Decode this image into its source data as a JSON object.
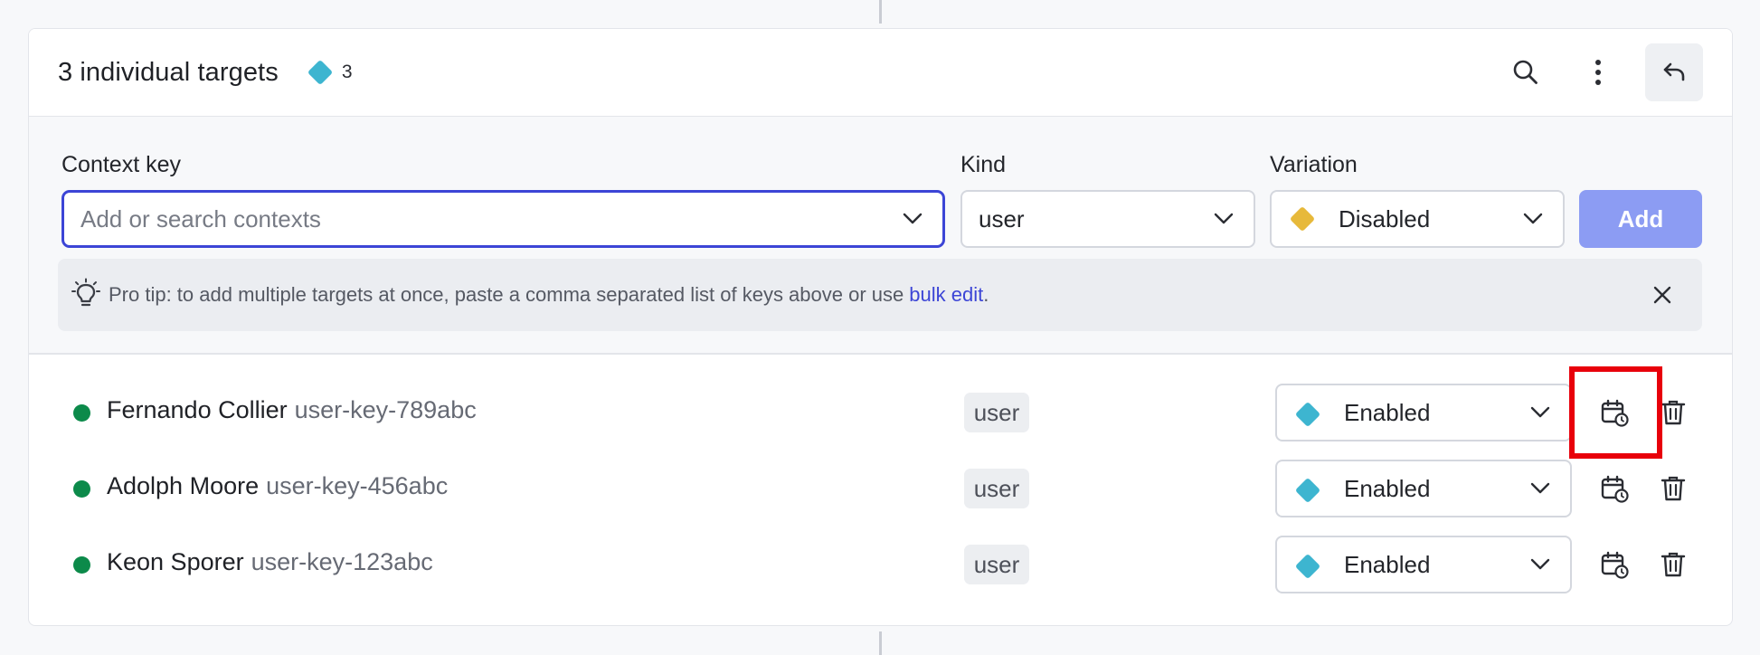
{
  "header": {
    "title": "3 individual targets",
    "count": "3",
    "count_icon": "teal-diamond-icon",
    "actions": [
      "search-icon",
      "more-vertical-icon",
      "undo-icon"
    ]
  },
  "form": {
    "context_label": "Context key",
    "context_placeholder": "Add or search contexts",
    "kind_label": "Kind",
    "kind_value": "user",
    "variation_label": "Variation",
    "variation_value": "Disabled",
    "variation_color": "#e7b93a",
    "add_label": "Add"
  },
  "tip": {
    "text": "Pro tip: to add multiple targets at once, paste a comma separated list of keys above or use",
    "link": "bulk edit",
    "suffix": "."
  },
  "targets": [
    {
      "name": "Fernando Collier",
      "key": "user-key-789abc",
      "kind": "user",
      "variation": "Enabled",
      "status_color": "#0c8a4a"
    },
    {
      "name": "Adolph Moore",
      "key": "user-key-456abc",
      "kind": "user",
      "variation": "Enabled",
      "status_color": "#0c8a4a"
    },
    {
      "name": "Keon Sporer",
      "key": "user-key-123abc",
      "kind": "user",
      "variation": "Enabled",
      "status_color": "#0c8a4a"
    }
  ],
  "colors": {
    "accent": "#3c45d6",
    "enabled_variation": "#3db5d0",
    "highlight": "#e8000b"
  }
}
